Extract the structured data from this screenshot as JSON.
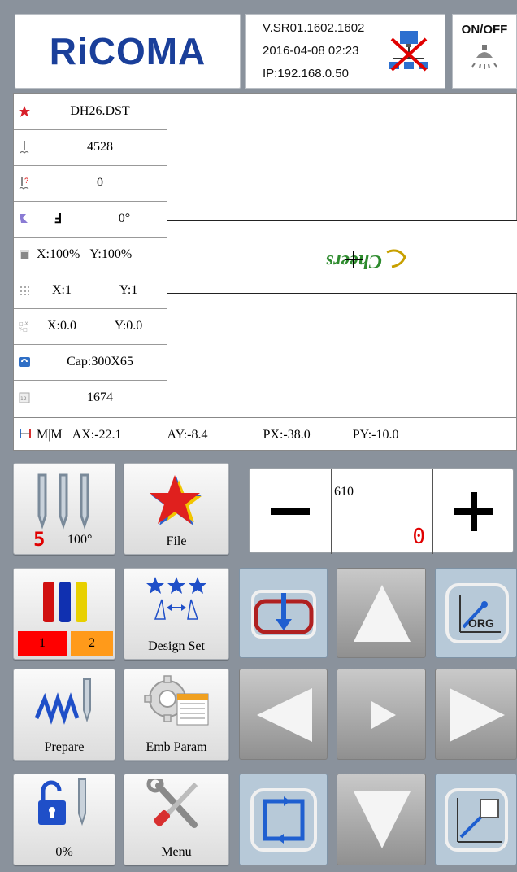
{
  "header": {
    "logo_text": "RiCOMA",
    "version": "V.SR01.1602.1602",
    "datetime": "2016-04-08  02:23",
    "ip": "IP:192.168.0.50",
    "onoff_label": "ON/OFF"
  },
  "status": {
    "file_name": "DH26.DST",
    "stitches": "4528",
    "needle_zero": "0",
    "rotate_glyph": "Ⅎ",
    "angle": "0°",
    "scale_x": "X:100%",
    "scale_y": "Y:100%",
    "repeat_x": "X:1",
    "repeat_y": "Y:1",
    "spacing_x": "X:0.0",
    "spacing_y": "Y:0.0",
    "hoop": "Cap:300X65",
    "memory": "1674",
    "design_text": "Cheers"
  },
  "coords": {
    "mode": "M|M",
    "ax": "AX:-22.1",
    "ay": "AY:-8.4",
    "px": "PX:-38.0",
    "py": "PY:-10.0"
  },
  "controls": {
    "needle_number": "5",
    "needle_angle": "100°",
    "file_label": "File",
    "counter_max": "610",
    "counter_value": "0",
    "color_1": "1",
    "color_2": "2",
    "design_set_label": "Design  Set",
    "prepare_label": "Prepare",
    "emb_param_label": "Emb  Param",
    "lock_percent": "0%",
    "menu_label": "Menu",
    "org_label": "ORG"
  },
  "colors": {
    "logo_blue": "#1a3f9a",
    "panel_bg": "#8a929c",
    "accent_red": "#e00000",
    "nav_blue": "#b7c9d8"
  }
}
